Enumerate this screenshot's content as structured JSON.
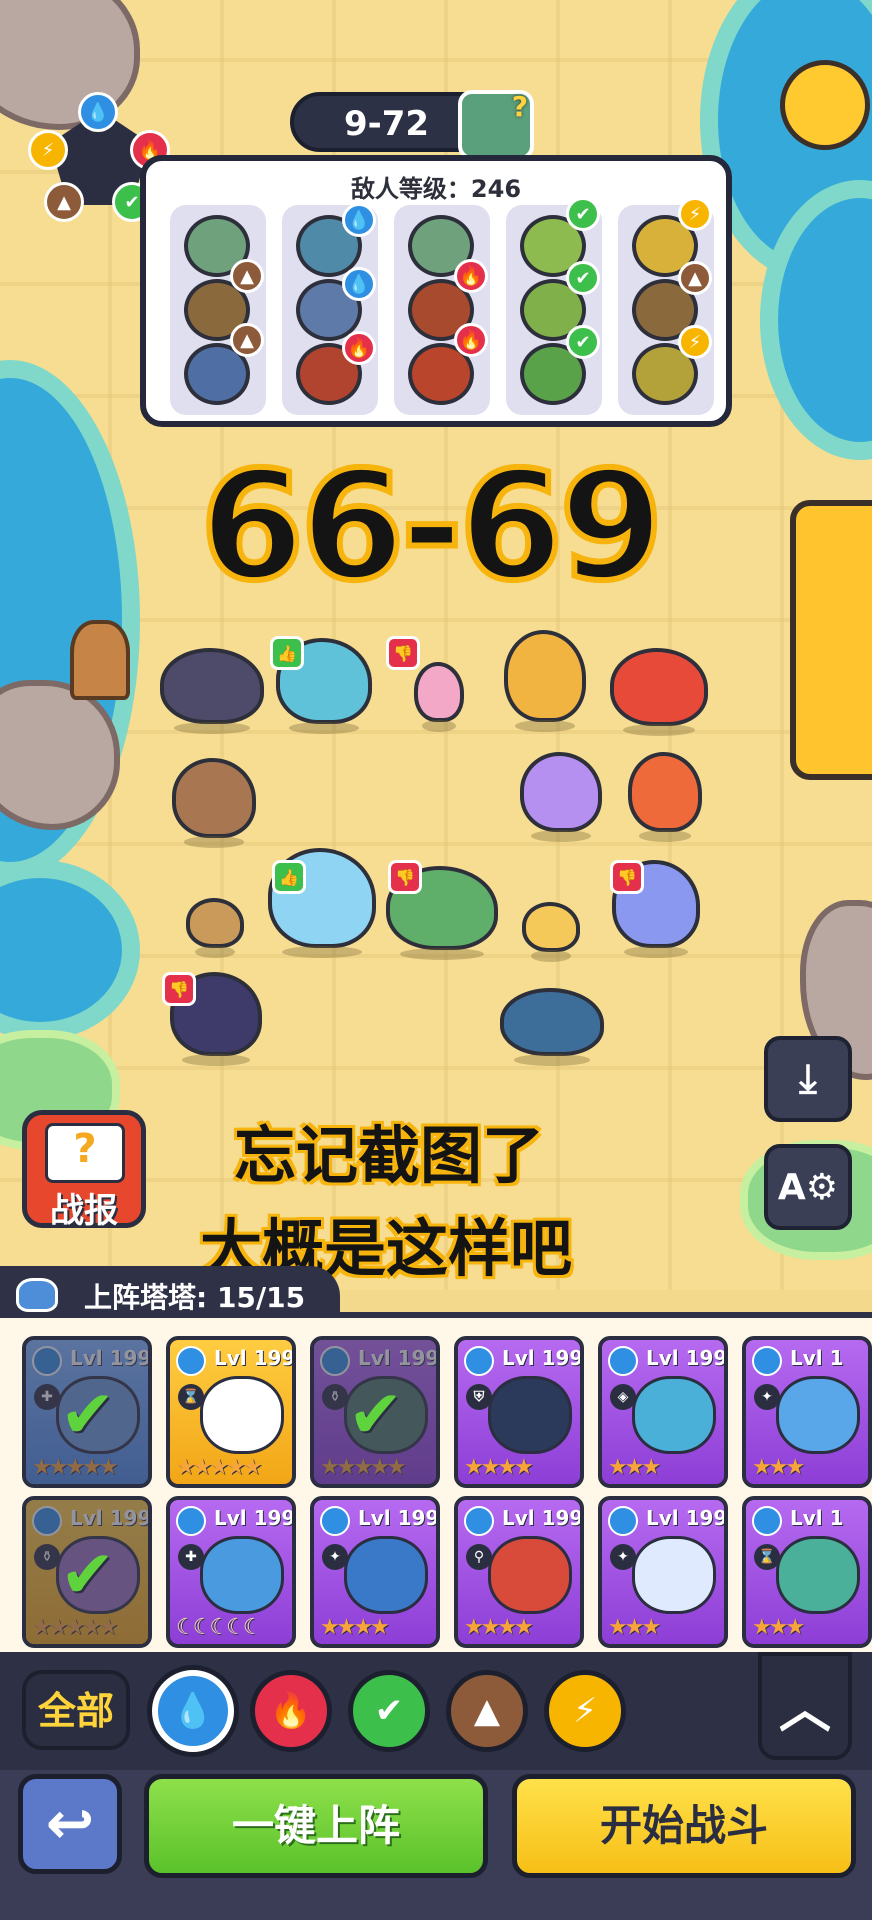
{
  "level": {
    "stage": "9-72"
  },
  "enemy_panel": {
    "title": "敌人等级：246"
  },
  "overlay": {
    "range_text": "66-69",
    "line1": "忘记截图了",
    "line2": "大概是这样吧"
  },
  "battle_report": {
    "icon": "?",
    "label": "战报"
  },
  "roster": {
    "header": "上阵塔塔: 15/15"
  },
  "cards": [
    {
      "level": "Lvl 199",
      "deployed": true
    },
    {
      "level": "Lvl 199",
      "deployed": false
    },
    {
      "level": "Lvl 199",
      "deployed": true
    },
    {
      "level": "Lvl 199",
      "deployed": false
    },
    {
      "level": "Lvl 199",
      "deployed": false
    },
    {
      "level": "Lvl 1",
      "deployed": false
    },
    {
      "level": "Lvl 199",
      "deployed": true
    },
    {
      "level": "Lvl 199",
      "deployed": false
    },
    {
      "level": "Lvl 199",
      "deployed": false
    },
    {
      "level": "Lvl 199",
      "deployed": false
    },
    {
      "level": "Lvl 199",
      "deployed": false
    },
    {
      "level": "Lvl 1",
      "deployed": false
    }
  ],
  "filter": {
    "all_label": "全部",
    "selected": "water"
  },
  "buttons": {
    "deploy_label": "一键上阵",
    "start_label": "开始战斗"
  },
  "colors": {
    "accent_yellow": "#f7bf16",
    "accent_green": "#5bc22b",
    "water": "#2f8fe3",
    "fire": "#e5304b",
    "grass": "#3cbf4b",
    "earth": "#8d5b3a",
    "thunder": "#f7b500"
  }
}
